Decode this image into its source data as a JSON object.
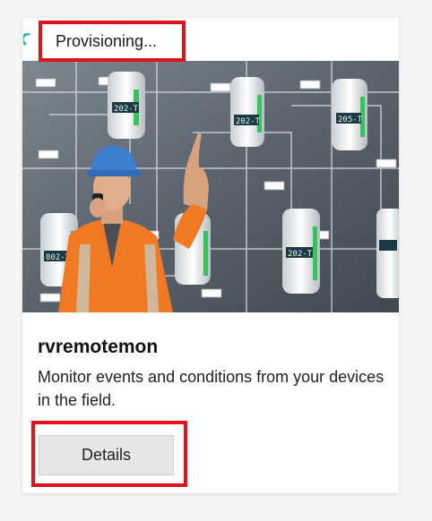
{
  "card": {
    "status": "Provisioning...",
    "title": "rvremotemon",
    "description": "Monitor events and conditions from your devices in the field.",
    "details_label": "Details",
    "hero_readouts": [
      "202-T",
      "202-T",
      "205-T",
      "802-T",
      "202-T"
    ]
  },
  "colors": {
    "accent_teal": "#2fb6a3",
    "highlight_red": "#e0121b",
    "vest_orange": "#f07a24"
  }
}
